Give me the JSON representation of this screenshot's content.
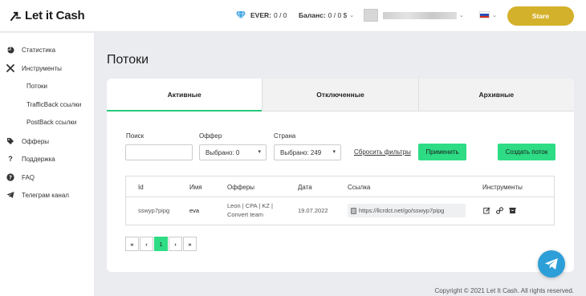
{
  "header": {
    "brand": "Let it Cash",
    "ever_label": "EVER:",
    "ever_value": "0 / 0",
    "balance_label": "Баланс:",
    "balance_value": "0 / 0 $",
    "stare_button": "Stare",
    "lang_flag": "ru-flag",
    "accent_color": "#d4b12a"
  },
  "sidebar": {
    "items": [
      {
        "label": "Статистика",
        "icon": "pie-chart-icon"
      },
      {
        "label": "Инструменты",
        "icon": "tools-icon"
      },
      {
        "label": "Потоки",
        "icon": ""
      },
      {
        "label": "TrafficBack ссылки",
        "icon": ""
      },
      {
        "label": "PostBack ссылки",
        "icon": ""
      },
      {
        "label": "Офферы",
        "icon": "tag-icon"
      },
      {
        "label": "Поддержка",
        "icon": "question-icon"
      },
      {
        "label": "FAQ",
        "icon": "question-circle-icon"
      },
      {
        "label": "Телеграм канал",
        "icon": "telegram-icon"
      }
    ]
  },
  "main": {
    "title": "Потоки",
    "tabs": [
      {
        "label": "Активные",
        "active": true
      },
      {
        "label": "Отключенные",
        "active": false
      },
      {
        "label": "Архивные",
        "active": false
      }
    ],
    "filters": {
      "search_label": "Поиск",
      "search_value": "",
      "offer_label": "Оффер",
      "offer_value": "Выбрано: 0",
      "country_label": "Страна",
      "country_value": "Выбрано: 249",
      "reset_link": "Сбросить фильтры",
      "apply_button": "Применить",
      "create_button": "Создать поток"
    },
    "table": {
      "headers": [
        "Id",
        "Имя",
        "Офферы",
        "Дата",
        "Ссылка",
        "Инструменты"
      ],
      "rows": [
        {
          "id": "sswyp7pipg",
          "name": "eva",
          "offers_line1": "Leon | CPA | KZ |",
          "offers_line2": "Convert team",
          "date": "19.07.2022",
          "link": "https://llcrdct.net/go/sswyp7pipg"
        }
      ]
    },
    "pagination": {
      "first": "«",
      "prev": "‹",
      "current": "1",
      "next": "›",
      "last": "»"
    }
  },
  "footer": {
    "copyright": "Copyright © 2021 Let It Cash. All rights reserved."
  },
  "colors": {
    "green": "#2ddc84",
    "telegram": "#2d9fd8"
  }
}
